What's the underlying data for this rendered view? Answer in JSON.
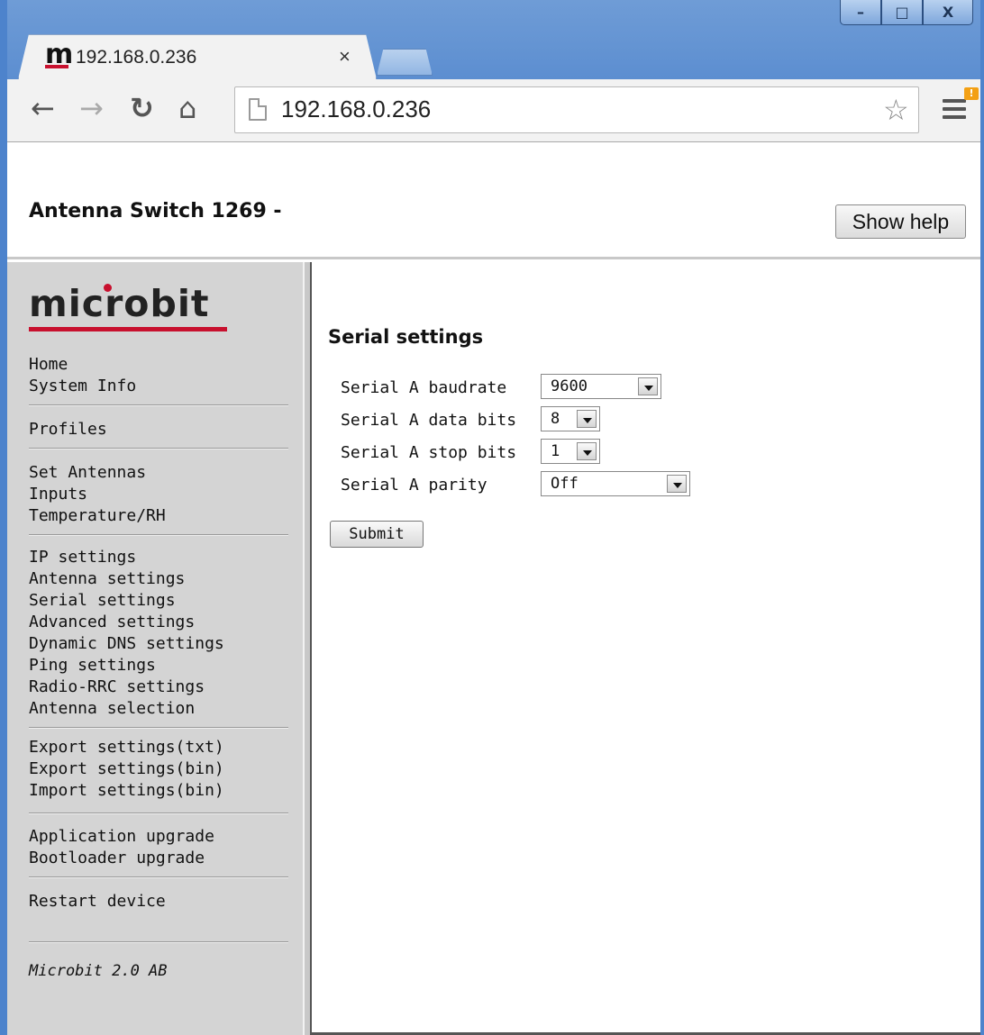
{
  "browser": {
    "tab_title": "192.168.0.236",
    "tab_close": "×",
    "url": "192.168.0.236",
    "favicon_letter": "m",
    "menu_badge": "!",
    "window_controls": {
      "minimize": "–",
      "maximize": "□",
      "close": "X"
    }
  },
  "header": {
    "title": "Antenna Switch 1269 -",
    "help_button": "Show help"
  },
  "sidebar": {
    "logo": "microbit",
    "groups": [
      [
        "Home",
        "System Info"
      ],
      [
        "Profiles"
      ],
      [
        "Set Antennas",
        "Inputs",
        "Temperature/RH"
      ],
      [
        "IP settings",
        "Antenna settings",
        "Serial settings",
        "Advanced settings",
        "Dynamic DNS settings",
        "Ping settings",
        "Radio-RRC settings",
        "Antenna selection"
      ],
      [
        "Export settings(txt)",
        "Export settings(bin)",
        "Import settings(bin)"
      ],
      [
        "Application upgrade",
        "Bootloader upgrade"
      ],
      [
        "Restart device"
      ]
    ],
    "footer": "Microbit 2.0 AB"
  },
  "main": {
    "title": "Serial settings",
    "fields": [
      {
        "label": "Serial A baudrate",
        "value": "9600"
      },
      {
        "label": "Serial A data bits",
        "value": "8"
      },
      {
        "label": "Serial A stop bits",
        "value": "1"
      },
      {
        "label": "Serial A parity",
        "value": "Off"
      }
    ],
    "submit": "Submit"
  },
  "colors": {
    "brand_red": "#c8102e",
    "sidebar_bg": "#d4d4d4",
    "window_blue": "#4d83cc"
  }
}
